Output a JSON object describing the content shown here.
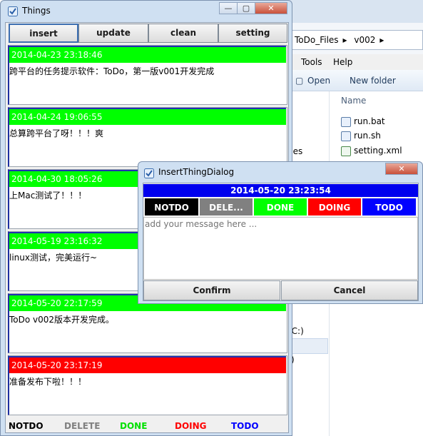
{
  "explorer": {
    "breadcrumb": [
      "ToDo_Files",
      "v002"
    ],
    "menu": [
      "Tools",
      "Help"
    ],
    "commands": {
      "open": "Open",
      "new_folder": "New folder"
    },
    "column_header": "Name",
    "nav_labels": [
      "ces",
      "(C:)",
      ":)"
    ],
    "files": [
      "run.bat",
      "run.sh",
      "setting.xml"
    ]
  },
  "things": {
    "title": "Things",
    "toolbar": {
      "insert": "insert",
      "update": "update",
      "clean": "clean",
      "setting": "setting"
    },
    "items": [
      {
        "time": "2014-04-23 23:18:46",
        "message": "跨平台的任务提示软件：ToDo，第一版v001开发完成",
        "status": "done"
      },
      {
        "time": "2014-04-24 19:06:55",
        "message": "总算跨平台了呀！！！爽",
        "status": "done"
      },
      {
        "time": "2014-04-30 18:05:26",
        "message": "上Mac测试了！！！",
        "status": "done"
      },
      {
        "time": "2014-05-19 23:16:32",
        "message": "linux测试，完美运行~",
        "status": "done"
      },
      {
        "time": "2014-05-20 22:17:59",
        "message": "ToDo v002版本开发完成。",
        "status": "done"
      },
      {
        "time": "2014-05-20 23:17:19",
        "message": "准备发布下啦！！！",
        "status": "doing"
      }
    ],
    "legend": [
      {
        "label": "NOTDO",
        "color": "#000000"
      },
      {
        "label": "DELETE",
        "color": "#808080"
      },
      {
        "label": "DONE",
        "color": "#00e000"
      },
      {
        "label": "DOING",
        "color": "#ff0000"
      },
      {
        "label": "TODO",
        "color": "#0000ff"
      }
    ]
  },
  "dialog": {
    "title": "InsertThingDialog",
    "datetime": "2014-05-20 23:23:54",
    "states": [
      {
        "label": "NOTDO",
        "bg": "#000000",
        "fg": "#ffffff"
      },
      {
        "label": "DELE...",
        "bg": "#808080",
        "fg": "#ffffff"
      },
      {
        "label": "DONE",
        "bg": "#00ff00",
        "fg": "#ffffff"
      },
      {
        "label": "DOING",
        "bg": "#ff0000",
        "fg": "#ffffff"
      },
      {
        "label": "TODO",
        "bg": "#0000ff",
        "fg": "#ffffff"
      }
    ],
    "input_placeholder": "add your message here ...",
    "confirm": "Confirm",
    "cancel": "Cancel"
  },
  "icons": {
    "app": "todo-check-icon",
    "minimize": "minimize-icon",
    "maximize": "maximize-icon",
    "close": "close-icon"
  }
}
